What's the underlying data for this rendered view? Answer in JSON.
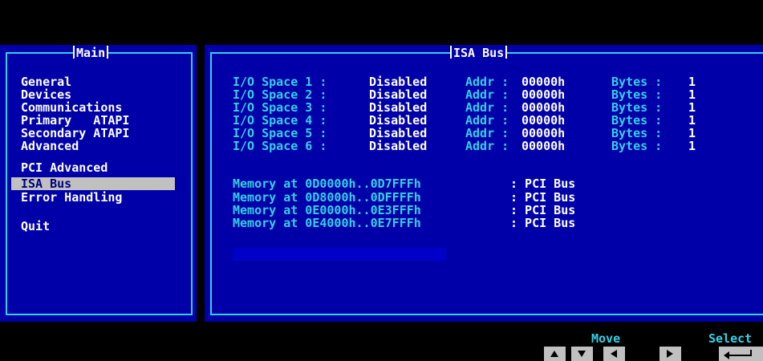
{
  "menu": {
    "title": "Main",
    "items": [
      {
        "label": "General"
      },
      {
        "label": "Devices"
      },
      {
        "label": "Communications"
      },
      {
        "label": "Primary   ATAPI"
      },
      {
        "label": "Secondary ATAPI"
      },
      {
        "label": "Advanced"
      },
      {
        "label": "PCI Advanced"
      },
      {
        "label": "ISA Bus",
        "selected": true
      },
      {
        "label": "Error Handling"
      },
      {
        "label": "Quit"
      }
    ]
  },
  "isa": {
    "title": "ISA Bus",
    "io_rows": [
      {
        "label": "I/O Space 1 :",
        "status": "Disabled",
        "addr_label": "Addr :",
        "addr": "00000h",
        "bytes_label": "Bytes :",
        "bytes": "1"
      },
      {
        "label": "I/O Space 2 :",
        "status": "Disabled",
        "addr_label": "Addr :",
        "addr": "00000h",
        "bytes_label": "Bytes :",
        "bytes": "1"
      },
      {
        "label": "I/O Space 3 :",
        "status": "Disabled",
        "addr_label": "Addr :",
        "addr": "00000h",
        "bytes_label": "Bytes :",
        "bytes": "1"
      },
      {
        "label": "I/O Space 4 :",
        "status": "Disabled",
        "addr_label": "Addr :",
        "addr": "00000h",
        "bytes_label": "Bytes :",
        "bytes": "1"
      },
      {
        "label": "I/O Space 5 :",
        "status": "Disabled",
        "addr_label": "Addr :",
        "addr": "00000h",
        "bytes_label": "Bytes :",
        "bytes": "1"
      },
      {
        "label": "I/O Space 6 :",
        "status": "Disabled",
        "addr_label": "Addr :",
        "addr": "00000h",
        "bytes_label": "Bytes :",
        "bytes": "1"
      }
    ],
    "memory_rows": [
      {
        "label": "Memory at 0D0000h..0D7FFFh",
        "value": ": PCI Bus"
      },
      {
        "label": "Memory at 0D8000h..0DFFFFh",
        "value": ": PCI Bus"
      },
      {
        "label": "Memory at 0E0000h..0E3FFFh",
        "value": ": PCI Bus"
      },
      {
        "label": "Memory at 0E4000h..0E7FFFh",
        "value": ": PCI Bus"
      }
    ]
  },
  "footer": {
    "move_label": "Move",
    "select_label": "Select",
    "keys": [
      "arrow-up-icon",
      "arrow-down-icon",
      "arrow-left-icon",
      "arrow-right-icon",
      "enter-icon"
    ]
  },
  "colors": {
    "panel_bg": "#0000a8",
    "frame": "#35d0e8",
    "text_white": "#ffffff",
    "text_cyan": "#35d0e8",
    "selection": "#c0c0c0"
  }
}
